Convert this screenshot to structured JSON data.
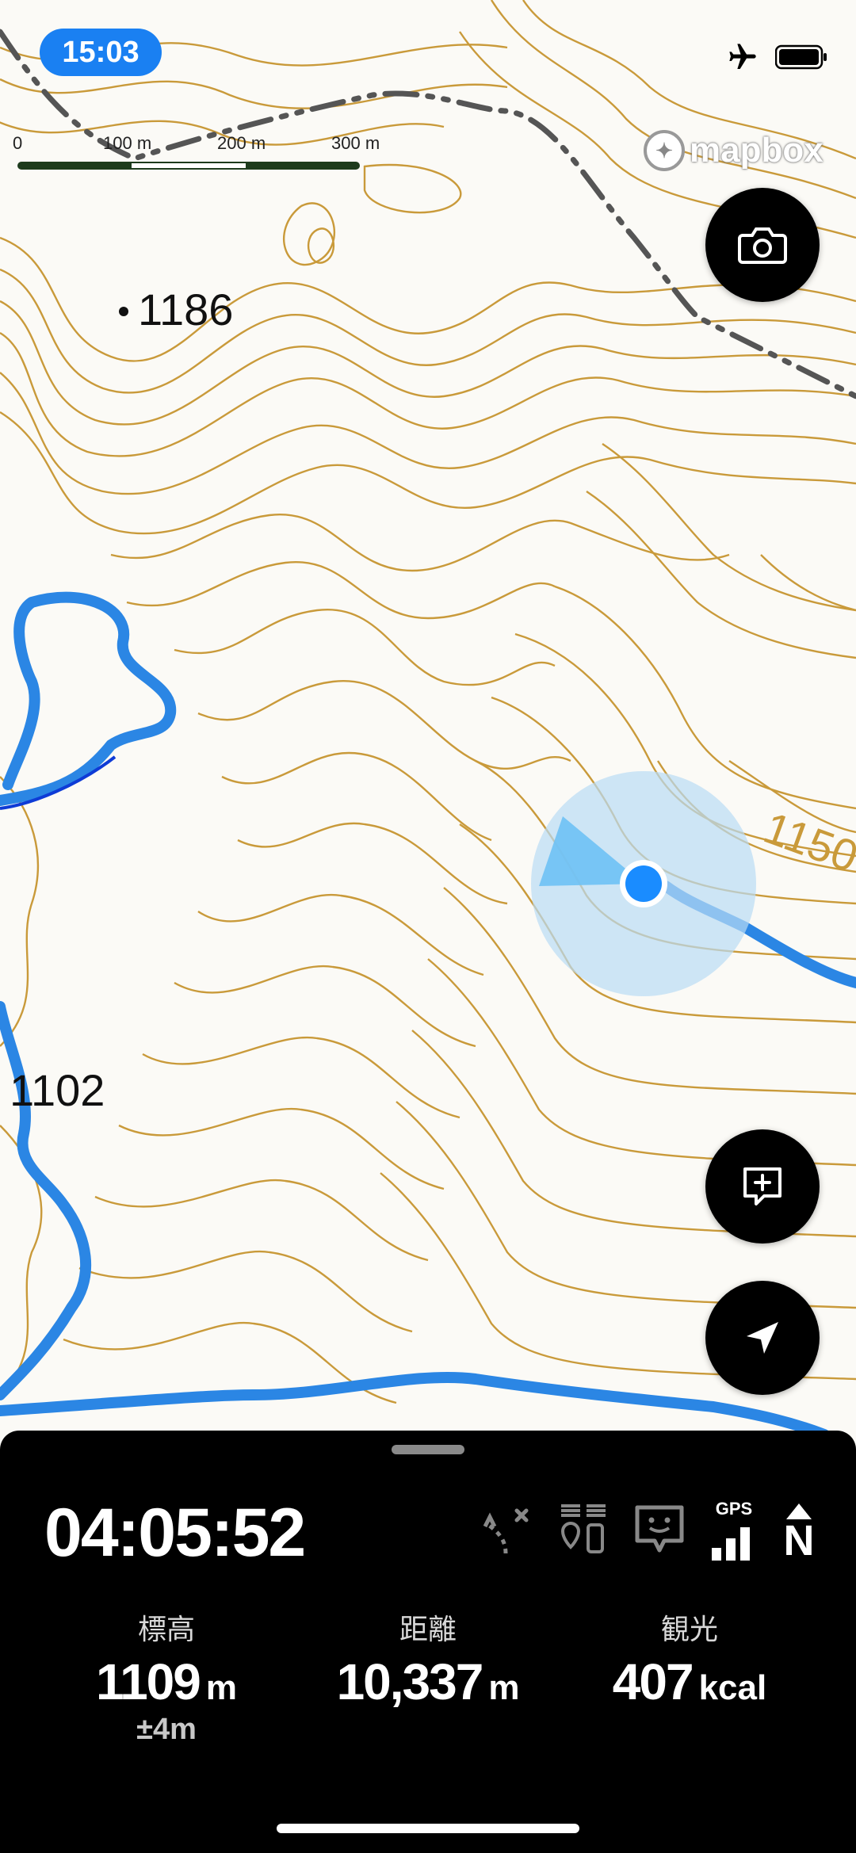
{
  "status_bar": {
    "time": "15:03",
    "airplane_icon": "airplane-icon",
    "battery_icon": "battery-icon"
  },
  "scale_bar": {
    "labels": [
      "0",
      "100 m",
      "200 m",
      "300 m"
    ]
  },
  "map": {
    "attribution": "mapbox",
    "elevation_labels": [
      "1186",
      "1102",
      "1150"
    ],
    "colors": {
      "contour": "#c99a3a",
      "route": "#2b86e4",
      "location": "#1a8cff",
      "heading_cone": "#6ec1f5",
      "accuracy": "#b9dcf5",
      "trail": "#555555"
    }
  },
  "buttons": {
    "camera": "camera-icon",
    "add_note": "add-note-icon",
    "locate": "location-arrow-icon"
  },
  "tracking": {
    "elapsed": "04:05:52",
    "status_icons": [
      "off-route-icon",
      "waypoint-icon",
      "memo-face-icon",
      "gps-signal-icon",
      "north-up-icon"
    ],
    "gps_label": "GPS",
    "north_label": "N"
  },
  "stats": {
    "elevation": {
      "label": "標高",
      "value": "1109",
      "unit": "m",
      "accuracy": "±4m"
    },
    "distance": {
      "label": "距離",
      "value": "10,337",
      "unit": "m"
    },
    "calories": {
      "label": "観光",
      "value": "407",
      "unit": "kcal"
    }
  }
}
